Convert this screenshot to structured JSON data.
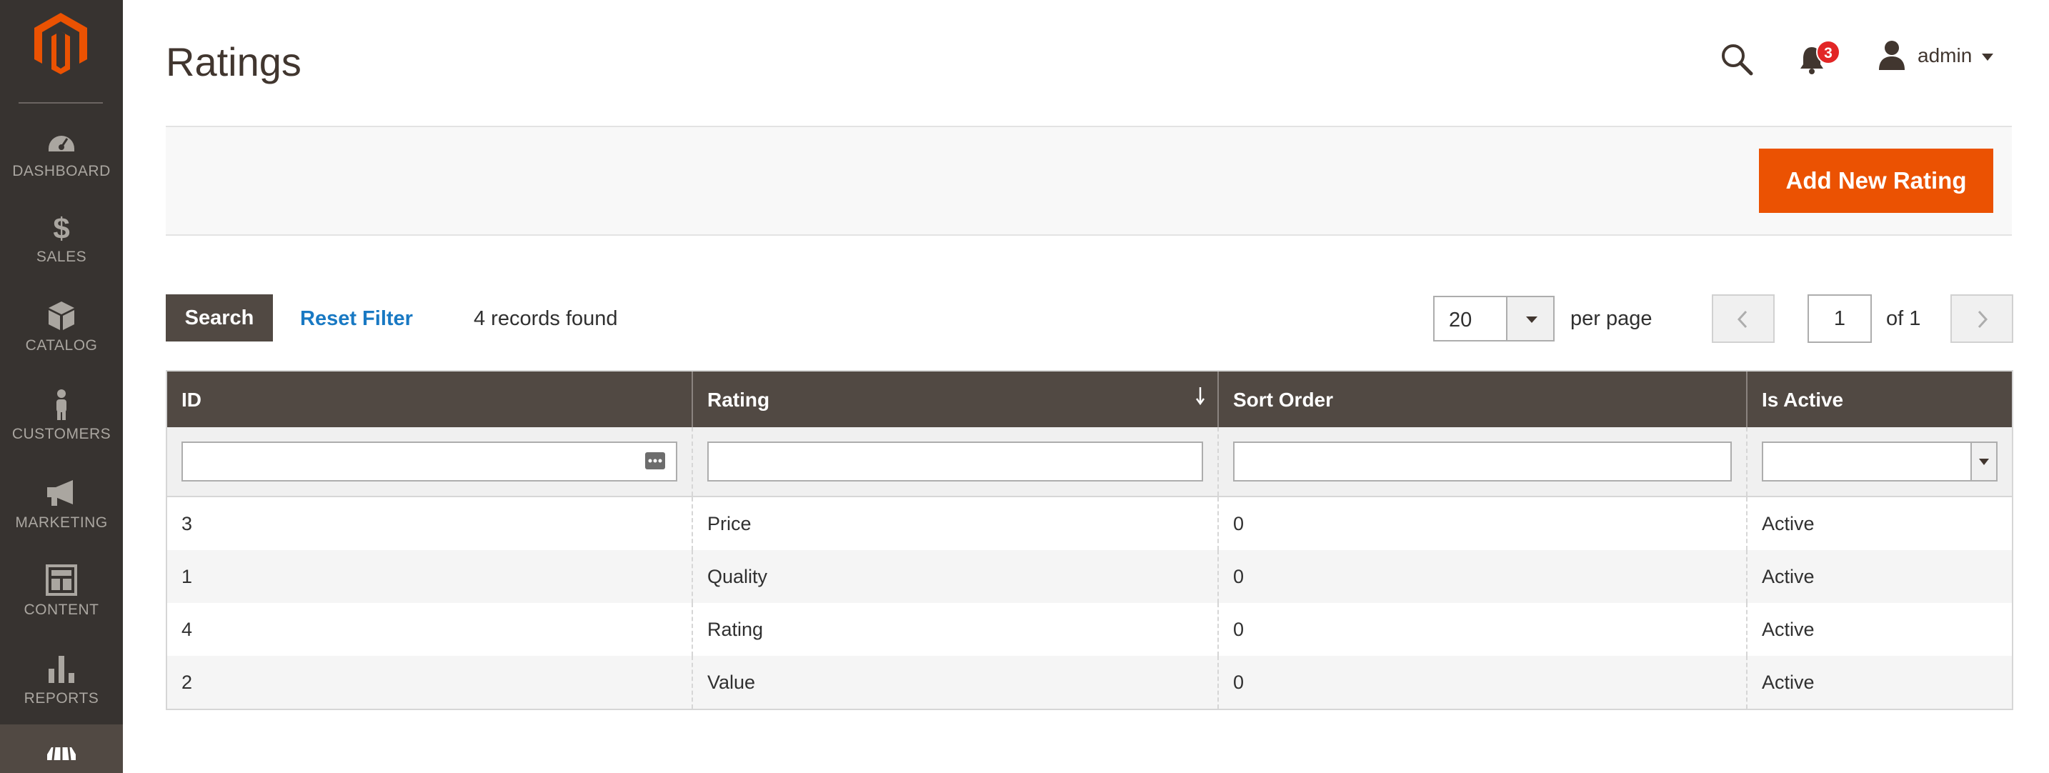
{
  "page": {
    "title": "Ratings"
  },
  "sidebar": {
    "items": [
      {
        "label": "DASHBOARD",
        "icon": "dashboard-icon"
      },
      {
        "label": "SALES",
        "icon": "dollar-icon"
      },
      {
        "label": "CATALOG",
        "icon": "box-icon"
      },
      {
        "label": "CUSTOMERS",
        "icon": "person-icon"
      },
      {
        "label": "MARKETING",
        "icon": "megaphone-icon"
      },
      {
        "label": "CONTENT",
        "icon": "layout-icon"
      },
      {
        "label": "REPORTS",
        "icon": "bar-chart-icon"
      },
      {
        "label": "",
        "icon": "store-icon"
      }
    ]
  },
  "header": {
    "notification_count": "3",
    "user_name": "admin"
  },
  "actions": {
    "add_label": "Add New Rating"
  },
  "toolbar": {
    "search_label": "Search",
    "reset_label": "Reset Filter",
    "records_text": "4 records found",
    "per_page_value": "20",
    "per_page_label": "per page",
    "current_page": "1",
    "page_of": "of 1"
  },
  "grid": {
    "columns": [
      "ID",
      "Rating",
      "Sort Order",
      "Is Active"
    ],
    "sorted_column": "Rating",
    "rows": [
      [
        "3",
        "Price",
        "0",
        "Active"
      ],
      [
        "1",
        "Quality",
        "0",
        "Active"
      ],
      [
        "4",
        "Rating",
        "0",
        "Active"
      ],
      [
        "2",
        "Value",
        "0",
        "Active"
      ]
    ]
  },
  "colors": {
    "brand_orange": "#eb5202",
    "sidebar_bg": "#373330",
    "header_bg": "#514943",
    "link_blue": "#1979c3",
    "badge_red": "#e22626"
  }
}
